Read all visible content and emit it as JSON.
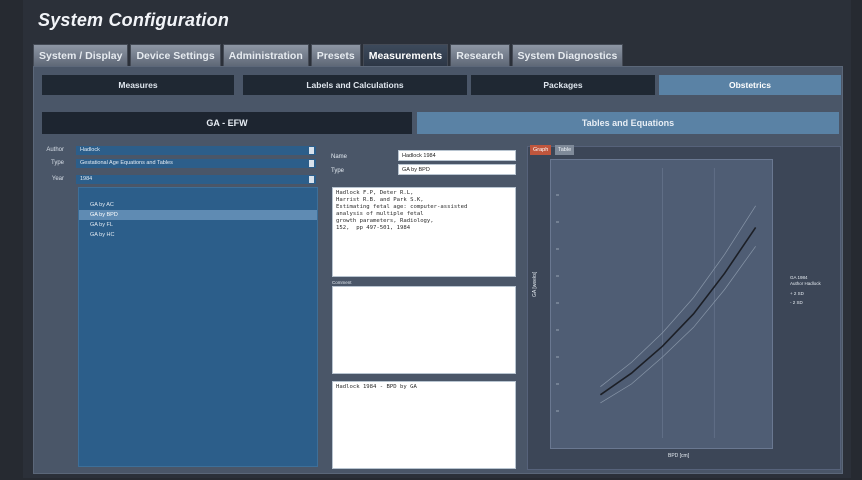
{
  "app": {
    "title": "System Configuration"
  },
  "main_tabs": [
    {
      "label": "System / Display",
      "active": false
    },
    {
      "label": "Device Settings",
      "active": false
    },
    {
      "label": "Administration",
      "active": false
    },
    {
      "label": "Presets",
      "active": false
    },
    {
      "label": "Measurements",
      "active": true
    },
    {
      "label": "Research",
      "active": false
    },
    {
      "label": "System Diagnostics",
      "active": false
    }
  ],
  "sub_tabs": [
    {
      "label": "Measures",
      "active": false
    },
    {
      "label": "Labels and Calculations",
      "active": false
    },
    {
      "label": "Packages",
      "active": false
    },
    {
      "label": "Obstetrics",
      "active": true
    }
  ],
  "section_tabs": [
    {
      "label": "GA - EFW",
      "active": false
    },
    {
      "label": "Tables and Equations",
      "active": true
    }
  ],
  "filters": {
    "author_label": "Author",
    "author_value": "Hadlock",
    "type_label": "Type",
    "type_value": "Gestational Age Equations and Tables",
    "year_label": "Year",
    "year_value": "1984"
  },
  "measure_list": [
    {
      "label": "GA by AC",
      "selected": false
    },
    {
      "label": "GA by BPD",
      "selected": true
    },
    {
      "label": "GA by FL",
      "selected": false
    },
    {
      "label": "GA by HC",
      "selected": false
    }
  ],
  "details": {
    "name_label": "Name",
    "name_value": "Hadlock 1984",
    "type_label": "Type",
    "type_value": "GA by BPD",
    "reference_text": "Hadlock F.P, Deter R.L,\nHarrist R.B. and Park S.K,\nEstimating fetal age: computer-assisted\nanalysis of multiple fetal\ngrowth parameters, Radiology,\n152,  pp 497-501, 1984",
    "comment_label": "Comment",
    "comment_text": "",
    "last_box_text": "Hadlock 1984 - BPD by GA"
  },
  "graph": {
    "tab_graph": "Graph",
    "tab_table": "Table",
    "x_axis_label": "BPD [cm]",
    "y_axis_label": "GA [weeks]",
    "legend": {
      "title_line1": "GA 1984",
      "title_line2": "Author Hadlock",
      "plus": "+ 2 SD",
      "minus": "- 2 SD"
    }
  },
  "chart_data": {
    "type": "line",
    "xlabel": "BPD [cm]",
    "ylabel": "GA [weeks]",
    "xlim": [
      0,
      1
    ],
    "ylim": [
      0,
      1
    ],
    "series": [
      {
        "name": "mean",
        "x": [
          0.2,
          0.35,
          0.5,
          0.65,
          0.8,
          0.95
        ],
        "y": [
          0.16,
          0.24,
          0.34,
          0.46,
          0.61,
          0.78
        ]
      },
      {
        "name": "+ 2 SD",
        "x": [
          0.2,
          0.35,
          0.5,
          0.65,
          0.8,
          0.95
        ],
        "y": [
          0.19,
          0.28,
          0.39,
          0.52,
          0.68,
          0.86
        ]
      },
      {
        "name": "- 2 SD",
        "x": [
          0.2,
          0.35,
          0.5,
          0.65,
          0.8,
          0.95
        ],
        "y": [
          0.13,
          0.2,
          0.3,
          0.41,
          0.55,
          0.71
        ]
      }
    ]
  }
}
